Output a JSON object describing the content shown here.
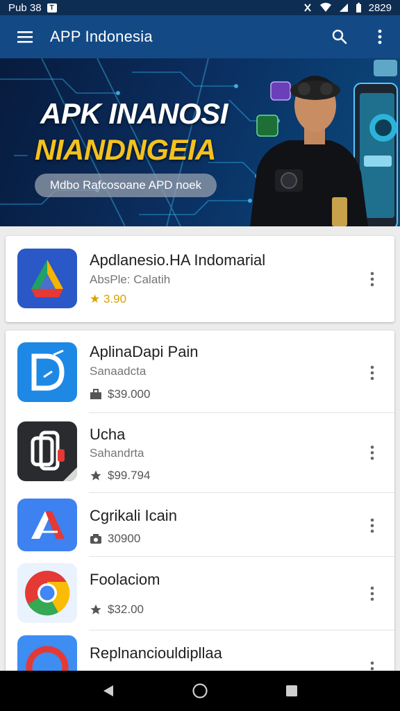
{
  "status_bar": {
    "time": "Pub 38",
    "right_text": "2829",
    "icons": [
      "notification-icon",
      "wifi-icon",
      "signal-icon",
      "battery-icon"
    ]
  },
  "app_bar": {
    "title": "APP Indonesia",
    "icons": [
      "menu-icon",
      "search-icon",
      "more-vert-icon"
    ],
    "color": "#134a86"
  },
  "banner": {
    "line1": "APK INANOSI",
    "line2": "NIANDNGEIA",
    "pill": "Mdbo Rafcosoane APD noek",
    "accent": "#f4c21d"
  },
  "featured": {
    "name": "Apdlanesio.HA Indomarial",
    "subtitle": "AbsPle: Calatih",
    "rating": "★ 3.90",
    "icon": "drive-icon"
  },
  "apps": [
    {
      "name": "AplinaDapi Pain",
      "subtitle": "Sanaadcta",
      "meta": "$39.000",
      "meta_icon": "briefcase-icon",
      "icon": "d-app-icon"
    },
    {
      "name": "Ucha",
      "subtitle": "Sahandrta",
      "meta": "$99.794",
      "meta_icon": "star-icon",
      "icon": "dark-app-icon"
    },
    {
      "name": "Cgrikali Icain",
      "subtitle": "",
      "meta": "30900",
      "meta_icon": "camera-icon",
      "icon": "a-app-icon"
    },
    {
      "name": "Foolaciom",
      "subtitle": "",
      "meta": "$32.00",
      "meta_icon": "star-icon",
      "icon": "chrome-icon"
    },
    {
      "name": "Replnanciouldipllaa",
      "subtitle": "",
      "meta": "",
      "meta_icon": "",
      "icon": "circle-app-icon"
    }
  ],
  "nav_bar": {
    "icons": [
      "back-icon",
      "home-icon",
      "recents-icon"
    ]
  }
}
